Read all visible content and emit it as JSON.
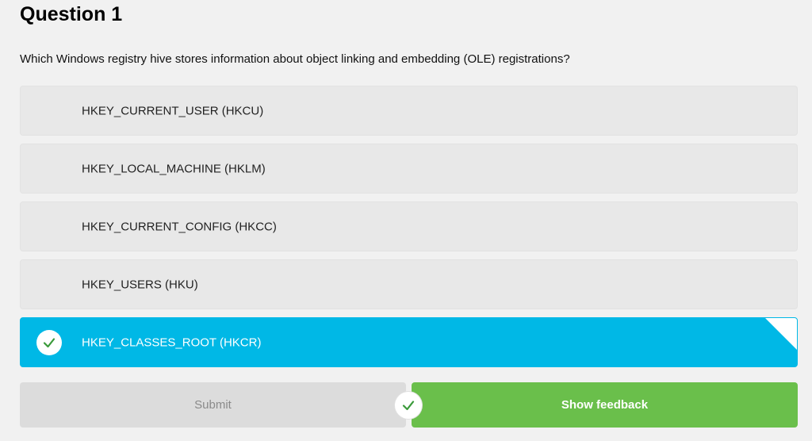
{
  "question": {
    "title": "Question 1",
    "text": "Which Windows registry hive stores information about object linking and embedding (OLE) registrations?"
  },
  "options": [
    {
      "label": "HKEY_CURRENT_USER (HKCU)",
      "selected": false
    },
    {
      "label": "HKEY_LOCAL_MACHINE (HKLM)",
      "selected": false
    },
    {
      "label": "HKEY_CURRENT_CONFIG (HKCC)",
      "selected": false
    },
    {
      "label": "HKEY_USERS (HKU)",
      "selected": false
    },
    {
      "label": "HKEY_CLASSES_ROOT (HKCR)",
      "selected": true
    }
  ],
  "buttons": {
    "submit_label": "Submit",
    "feedback_label": "Show feedback"
  },
  "colors": {
    "selected_option": "#00b8e6",
    "option_background": "#e8e8e8",
    "feedback_button": "#6abf4b",
    "submit_button": "#dcdcdc",
    "check_green": "#3a9a3a"
  },
  "icons": {
    "selected_check": "checkmark-icon",
    "status_check": "checkmark-icon"
  }
}
